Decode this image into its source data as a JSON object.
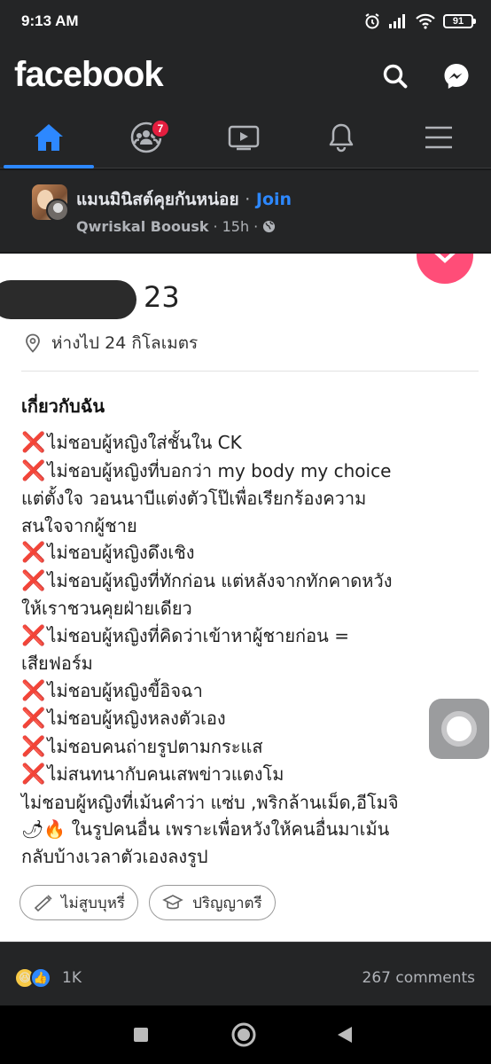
{
  "status_bar": {
    "time": "9:13 AM",
    "battery": "91"
  },
  "header": {
    "brand": "facebook",
    "search_icon": "search-icon",
    "messenger_icon": "messenger-icon"
  },
  "nav": {
    "tabs": [
      {
        "name": "home",
        "icon": "home-icon",
        "active": true
      },
      {
        "name": "groups",
        "icon": "groups-icon",
        "badge": "7"
      },
      {
        "name": "watch",
        "icon": "video-icon"
      },
      {
        "name": "notifications",
        "icon": "bell-icon"
      },
      {
        "name": "menu",
        "icon": "menu-icon"
      }
    ],
    "groups_badge": "7",
    "accent_color": "#2d88ff"
  },
  "post": {
    "group_name": "แมนมินิสต์คุยกันหน่อย",
    "separator": "·",
    "join_label": "Join",
    "author": "Qwriskal Boousk",
    "time": "15h",
    "meta_sep": "·",
    "audience_icon": "globe-icon"
  },
  "profile": {
    "age": "23",
    "distance": "ห่างไป 24 กิโลเมตร",
    "about_title": "เกี่ยวกับฉัน",
    "about_lines": [
      {
        "x": true,
        "text": "ไม่ชอบผู้หญิงใส่ชั้นใน CK"
      },
      {
        "x": true,
        "text": "ไม่ชอบผู้หญิงที่บอกว่า my body my choice"
      },
      {
        "x": false,
        "text": "แต่ตั้งใจ วอนนาบีแต่งตัวโป๊เพื่อเรียกร้องความ"
      },
      {
        "x": false,
        "text": "สนใจจากผู้ชาย"
      },
      {
        "x": true,
        "text": "ไม่ชอบผู้หญิงดึงเชิง"
      },
      {
        "x": true,
        "text": "ไม่ชอบผู้หญิงที่ทักก่อน แต่หลังจากทักคาดหวัง"
      },
      {
        "x": false,
        "text": "ให้เราชวนคุยฝ่ายเดียว"
      },
      {
        "x": true,
        "text": "ไม่ชอบผู้หญิงที่คิดว่าเข้าหาผู้ชายก่อน ="
      },
      {
        "x": false,
        "text": "เสียฟอร์ม"
      },
      {
        "x": true,
        "text": "ไม่ชอบผู้หญิงขี้อิจฉา"
      },
      {
        "x": true,
        "text": "ไม่ชอบผู้หญิงหลงตัวเอง"
      },
      {
        "x": true,
        "text": "ไม่ชอบคนถ่ายรูปตามกระแส"
      },
      {
        "x": true,
        "text": "ไม่สนทนากับคนเสพข่าวแตงโม"
      },
      {
        "x": false,
        "text": "ไม่ชอบผู้หญิงที่เม้นคำว่า แซ่บ ,พริกล้านเม็ด,อีโมจิ"
      },
      {
        "x": false,
        "emoji": "🌶🔥",
        "text": " ในรูปคนอื่น เพราะเพื่อหวังให้คนอื่นมาเม้น"
      },
      {
        "x": false,
        "text": "กลับบ้างเวลาตัวเองลงรูป"
      }
    ],
    "x_mark": "❌",
    "pills": [
      {
        "icon": "cigarette-icon",
        "label": "ไม่สูบบุหรี่"
      },
      {
        "icon": "graduation-cap-icon",
        "label": "ปริญญาตรี"
      }
    ]
  },
  "footer": {
    "reaction_count": "1K",
    "comments": "267 comments"
  }
}
